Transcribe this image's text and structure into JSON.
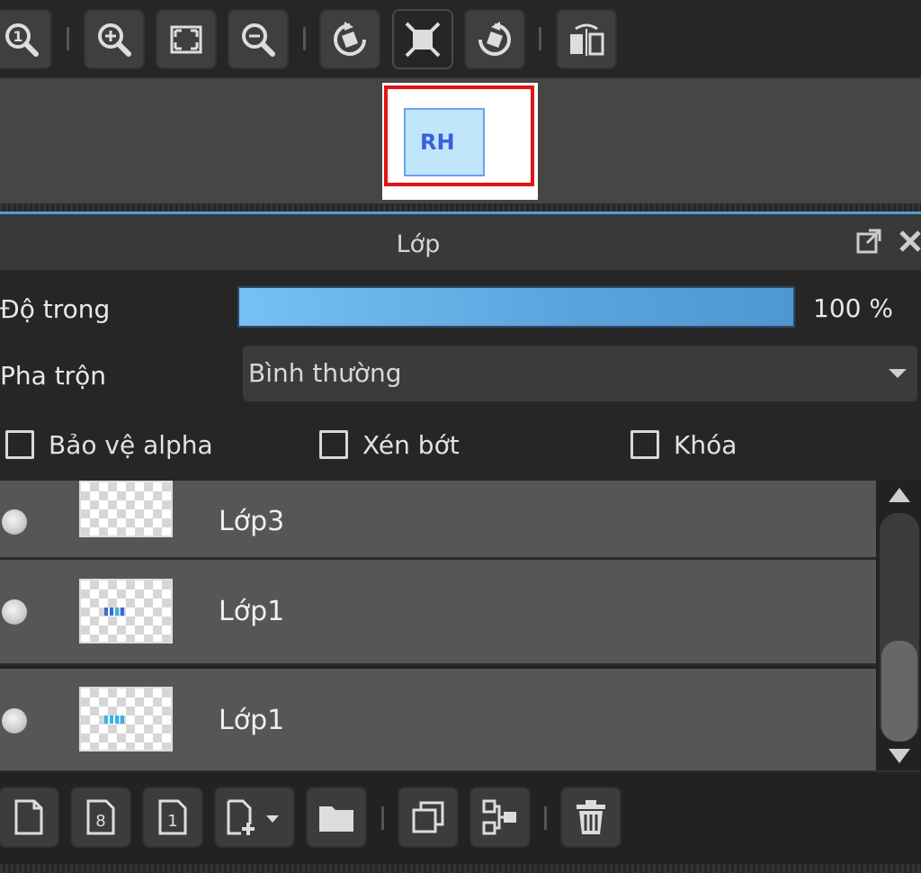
{
  "toolbar": {
    "buttons": [
      {
        "icon": "zoom-actual-size-icon"
      },
      {
        "icon": "zoom-in-icon"
      },
      {
        "icon": "fit-to-window-icon"
      },
      {
        "icon": "zoom-out-icon"
      },
      {
        "icon": "rotate-left-icon"
      },
      {
        "icon": "fit-canvas-icon"
      },
      {
        "icon": "rotate-right-icon"
      },
      {
        "icon": "flip-horizontal-icon"
      }
    ]
  },
  "navigator": {
    "frame_color": "#e01414"
  },
  "panel": {
    "title": "Lớp"
  },
  "properties": {
    "opacity_label": "Độ trong",
    "opacity_value": "100 %",
    "opacity_level": 1.0,
    "blend_label": "Pha trộn",
    "blend_value": "Bình thường",
    "protect_alpha_label": "Bảo vệ alpha",
    "clipping_label": "Xén bớt",
    "lock_label": "Khóa"
  },
  "layers": [
    {
      "name": "Lớp3"
    },
    {
      "name": "Lớp1"
    },
    {
      "name": "Lớp1"
    }
  ],
  "bottom_toolbar": {
    "buttons": [
      {
        "icon": "new-layer-icon"
      },
      {
        "icon": "new-8bit-layer-icon"
      },
      {
        "icon": "new-1bit-layer-icon"
      },
      {
        "icon": "add-layer-dropdown-icon"
      },
      {
        "icon": "folder-icon"
      },
      {
        "icon": "duplicate-layer-icon"
      },
      {
        "icon": "merge-down-icon"
      },
      {
        "icon": "delete-layer-icon"
      }
    ]
  },
  "colors": {
    "accent": "#4aa3d6",
    "opacity_bar": "#5aa3de",
    "panel_bg": "#262626"
  }
}
